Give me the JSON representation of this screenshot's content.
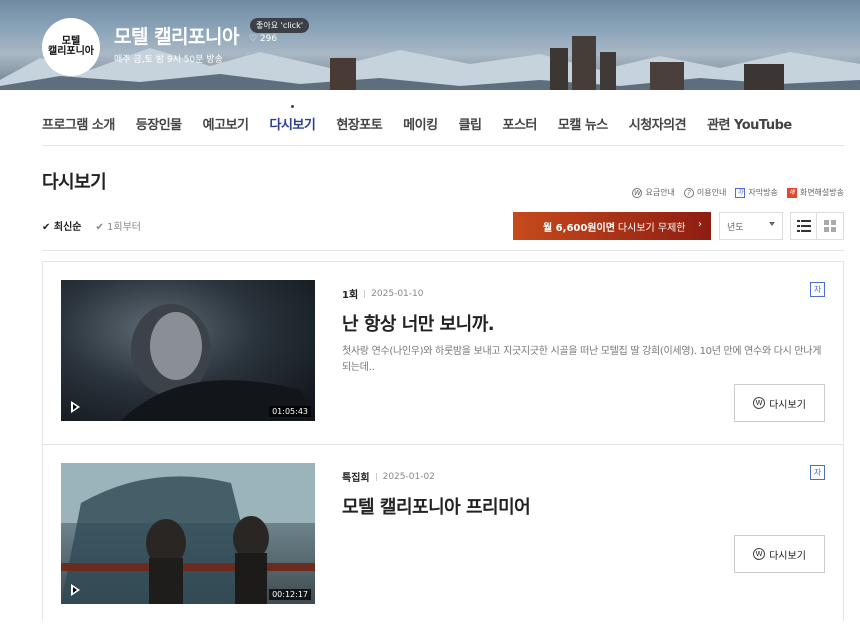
{
  "show": {
    "logo_text": "모텔\n캘리포니아",
    "title": "모텔 캘리포니아",
    "schedule": "매주 금,토 밤 9시 50분 방송",
    "like_badge": "좋아요 'click'",
    "like_count": "♡ 296"
  },
  "nav": {
    "items": [
      "프로그램 소개",
      "등장인물",
      "예고보기",
      "다시보기",
      "현장포토",
      "메이킹",
      "클립",
      "포스터",
      "모캘 뉴스",
      "시청자의견",
      "관련 YouTube"
    ],
    "active_index": 3
  },
  "page": {
    "title": "다시보기",
    "legend": [
      "요금안내",
      "이용안내",
      "자막방송",
      "화면해설방송"
    ],
    "sort_latest": "최신순",
    "sort_first": "1회부터",
    "promo_bold": "월 6,600원이면",
    "promo_rest": "다시보기 무제한",
    "year_placeholder": "년도"
  },
  "episodes": [
    {
      "number": "1회",
      "date": "2025-01-10",
      "title": "난 항상 너만 보니까.",
      "description": "첫사랑 연수(나인우)와 하룻밤을 보내고 지긋지긋한 시골을 떠난 모텔집 딸 강희(이세영). 10년 만에 연수와 다시 만나게 되는데..",
      "duration": "01:05:43",
      "badge": "자",
      "button": "다시보기"
    },
    {
      "number": "특집회",
      "date": "2025-01-02",
      "title": "모텔 캘리포니아 프리미어",
      "description": "",
      "duration": "00:12:17",
      "badge": "자",
      "button": "다시보기"
    }
  ],
  "colors": {
    "accent": "#2c3e8f",
    "promo_start": "#c64a1c",
    "promo_end": "#8e1d12",
    "subtitle_badge": "#4c6ed6"
  }
}
